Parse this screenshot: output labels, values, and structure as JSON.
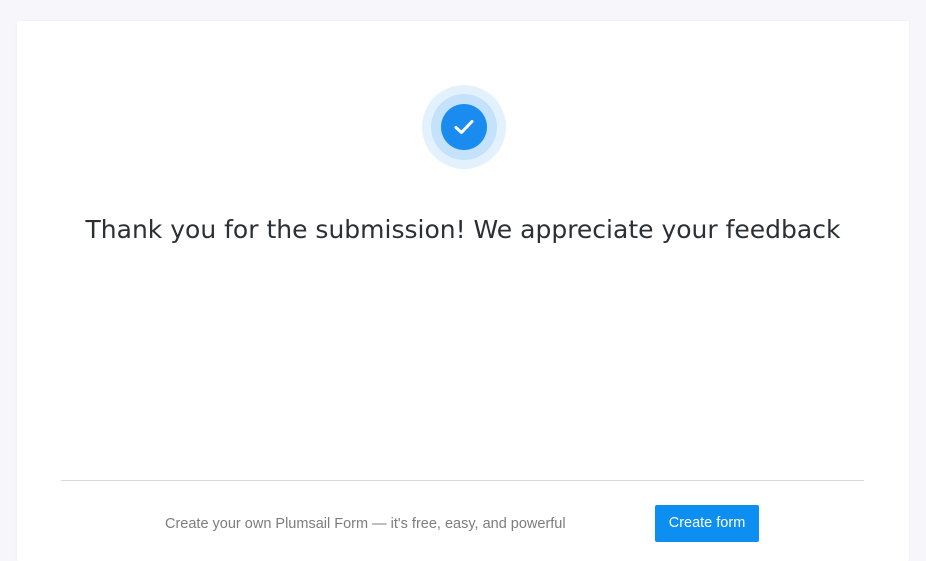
{
  "confirmation": {
    "icon": "check-circle-icon",
    "message": "Thank you for the submission! We appreciate your feedback"
  },
  "footer": {
    "promo_text": "Create your own Plumsail Form — it's free, easy, and powerful",
    "create_button_label": "Create form"
  },
  "colors": {
    "accent": "#1a8cf0",
    "button": "#0d8ff2",
    "background": "#f7f7fb",
    "title_text": "#2b2f36",
    "promo_text": "#7d7d7d"
  }
}
